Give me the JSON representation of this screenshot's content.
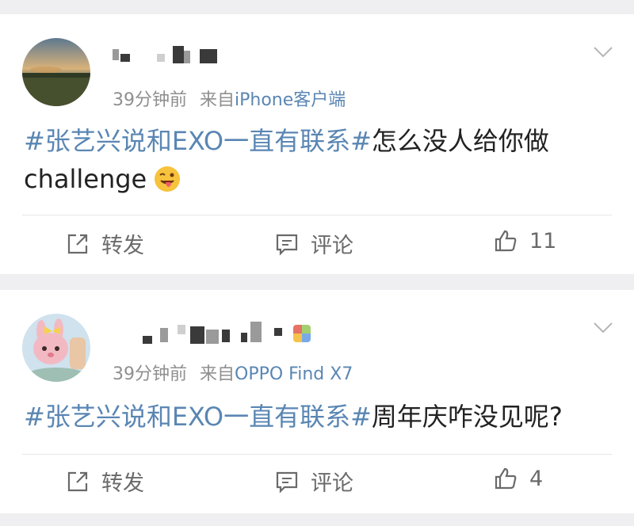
{
  "posts": [
    {
      "time": "39分钟前",
      "source_prefix": "来自",
      "source": "iPhone客户端",
      "hashtag": "#张艺兴说和EXO一直有联系#",
      "text": "怎么没人给你做challenge",
      "emoji": "tongue-out-emoji",
      "actions": {
        "repost": "转发",
        "comment": "评论",
        "like_count": "11"
      }
    },
    {
      "time": "39分钟前",
      "source_prefix": "来自",
      "source": "OPPO Find X7",
      "hashtag": "#张艺兴说和EXO一直有联系#",
      "text": "周年庆咋没见呢?",
      "actions": {
        "repost": "转发",
        "comment": "评论",
        "like_count": "4"
      }
    }
  ],
  "colors": {
    "link": "#5a86b3",
    "meta": "#8f8f8f",
    "background": "#efeff1"
  }
}
